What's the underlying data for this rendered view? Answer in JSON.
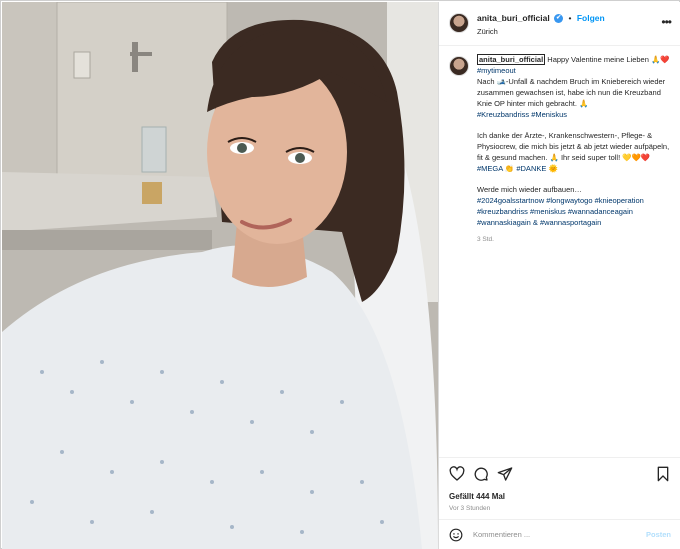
{
  "post": {
    "username": "anita_buri_official",
    "verified_glyph": "✔",
    "separator": "•",
    "follow_label": "Folgen",
    "location": "Zürich",
    "more_glyph": "•••"
  },
  "caption": {
    "line1": "Happy Valentine meine Lieben 🙏❤️",
    "tag_mytimeout": "#mytimeout",
    "para1": "Nach 🎿-Unfall & nachdem Bruch im Kniebereich wieder zusammen gewachsen ist, habe ich nun die Kreuzband Knie OP hinter mich gebracht. 🙏",
    "tags1": "#Kreuzbandriss #Meniskus",
    "para2": "Ich danke der Ärzte-, Krankenschwestern-, Pflege- & Physiocrew, die mich bis jetzt & ab jetzt wieder aufpäpeln, fit & gesund machen. 🙏 Ihr seid super toll! 💛🧡❤️",
    "tags2": "#MEGA 👏 #DANKE 🌞",
    "para3": "Werde mich wieder aufbauen…",
    "tags3": "#2024goalsstartnow #longwaytogo #knieoperation #kreuzbandriss #meniskus #wannadanceagain #wannaskiagain & #wannasportagain",
    "time": "3 Std."
  },
  "footer": {
    "likes": "Gefällt 444 Mal",
    "ago": "Vor 3 Stunden",
    "comment_placeholder": "Kommentieren ...",
    "post_label": "Posten"
  },
  "icons": [
    "heart-icon",
    "comment-icon",
    "share-icon",
    "bookmark-icon",
    "emoji-icon",
    "more-icon",
    "verified-icon"
  ],
  "colors": {
    "link": "#00376b",
    "follow": "#0095f6",
    "verified": "#3897f0",
    "muted": "#8e8e8e"
  }
}
